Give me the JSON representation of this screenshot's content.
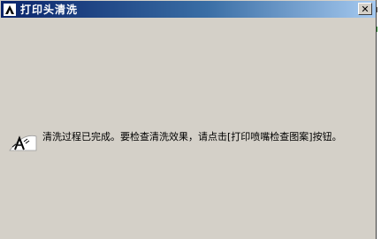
{
  "window": {
    "title": "打印头清洗",
    "close_label": "✕"
  },
  "message": {
    "text": "清洗过程已完成。要检查清洗效果，请点击[打印喷嘴检查图案]按钮。"
  },
  "icons": {
    "title_icon": "printer-nozzle-icon",
    "message_icon": "printer-cleaning-icon"
  },
  "colors": {
    "titlebar_start": "#0a246a",
    "titlebar_end": "#a6caf0",
    "dialog_background": "#d4d0c8"
  }
}
